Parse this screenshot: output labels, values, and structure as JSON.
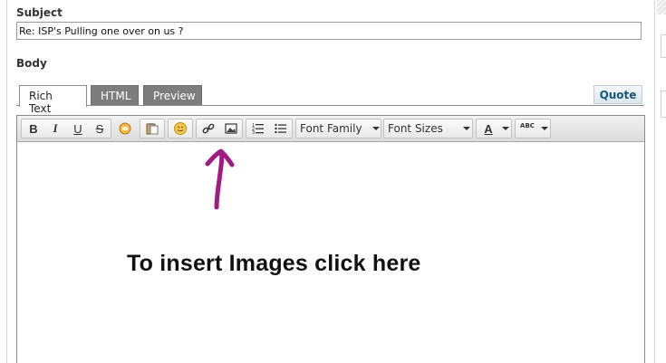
{
  "form": {
    "subject_label": "Subject",
    "subject_value": "Re: ISP's Pulling one over on us ?",
    "body_label": "Body"
  },
  "tabs": [
    {
      "label": "Rich Text",
      "active": true
    },
    {
      "label": "HTML",
      "active": false
    },
    {
      "label": "Preview",
      "active": false
    }
  ],
  "quote_button": "Quote",
  "toolbar": {
    "buttons": [
      {
        "icon": "bold-icon",
        "glyph": "B"
      },
      {
        "icon": "italic-icon",
        "glyph": "I"
      },
      {
        "icon": "underline-icon",
        "glyph": "U"
      },
      {
        "icon": "strikethrough-icon",
        "glyph": "S"
      },
      {
        "icon": "cleanup-icon"
      },
      {
        "icon": "paste-icon"
      },
      {
        "icon": "smiley-icon"
      },
      {
        "icon": "link-icon"
      },
      {
        "icon": "image-icon"
      },
      {
        "icon": "ordered-list-icon"
      },
      {
        "icon": "unordered-list-icon"
      },
      {
        "icon": "text-color-icon",
        "glyph": "A"
      },
      {
        "icon": "spellcheck-icon",
        "glyph": "ABC"
      }
    ],
    "font_family_label": "Font Family",
    "font_sizes_label": "Font Sizes"
  },
  "annotation": {
    "text": "To insert Images click here",
    "arrow_color": "#a01a82"
  },
  "colors": {
    "tab_inactive": "#7d7d7d",
    "quote_text": "#15567a"
  }
}
